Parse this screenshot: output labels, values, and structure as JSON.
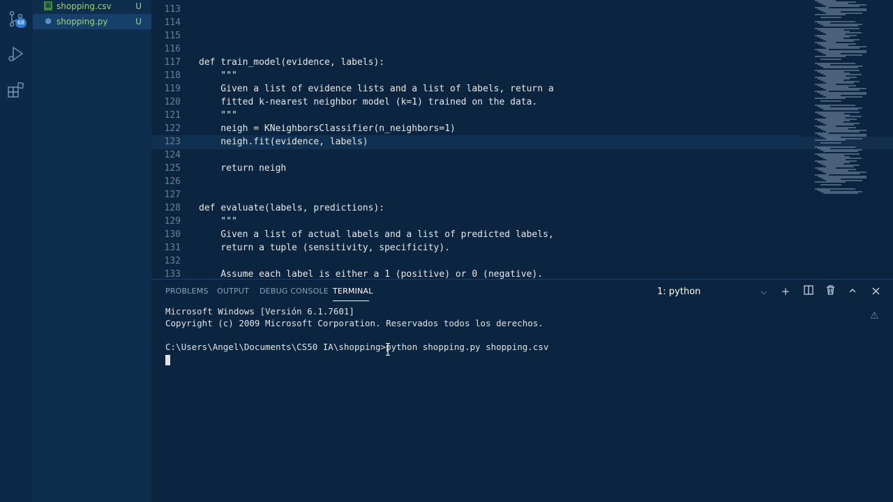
{
  "activity_bar": {
    "badge": "68",
    "icons": [
      "source-control-icon",
      "run-debug-icon",
      "extensions-icon"
    ]
  },
  "sidebar": {
    "files": [
      {
        "name": "shopping.csv",
        "status": "U",
        "icon": "csv-file-icon"
      },
      {
        "name": "shopping.py",
        "status": "U",
        "icon": "python-file-icon"
      }
    ]
  },
  "editor": {
    "lines": [
      {
        "n": "113",
        "code": ""
      },
      {
        "n": "114",
        "code": ""
      },
      {
        "n": "115",
        "code": ""
      },
      {
        "n": "116",
        "code": ""
      },
      {
        "n": "117",
        "code": "def train_model(evidence, labels):"
      },
      {
        "n": "118",
        "code": "    \"\"\""
      },
      {
        "n": "119",
        "code": "    Given a list of evidence lists and a list of labels, return a"
      },
      {
        "n": "120",
        "code": "    fitted k-nearest neighbor model (k=1) trained on the data."
      },
      {
        "n": "121",
        "code": "    \"\"\""
      },
      {
        "n": "122",
        "code": "    neigh = KNeighborsClassifier(n_neighbors=1)"
      },
      {
        "n": "123",
        "code": "    neigh.fit(evidence, labels)"
      },
      {
        "n": "124",
        "code": ""
      },
      {
        "n": "125",
        "code": "    return neigh"
      },
      {
        "n": "126",
        "code": ""
      },
      {
        "n": "127",
        "code": ""
      },
      {
        "n": "128",
        "code": "def evaluate(labels, predictions):"
      },
      {
        "n": "129",
        "code": "    \"\"\""
      },
      {
        "n": "130",
        "code": "    Given a list of actual labels and a list of predicted labels,"
      },
      {
        "n": "131",
        "code": "    return a tuple (sensitivity, specificity)."
      },
      {
        "n": "132",
        "code": ""
      },
      {
        "n": "133",
        "code": "    Assume each label is either a 1 (positive) or 0 (negative)."
      }
    ]
  },
  "panel": {
    "tabs": [
      "PROBLEMS",
      "OUTPUT",
      "DEBUG CONSOLE",
      "TERMINAL"
    ],
    "active_tab": "TERMINAL",
    "terminal_select": "1: python",
    "terminal_lines": [
      "Microsoft Windows [Versión 6.1.7601]",
      "Copyright (c) 2009 Microsoft Corporation. Reservados todos los derechos.",
      "",
      "C:\\Users\\Angel\\Documents\\CS50 IA\\shopping>python shopping.py shopping.csv"
    ],
    "buttons": [
      "plus-icon",
      "split-terminal-icon",
      "trash-icon",
      "chevron-up-icon",
      "close-icon"
    ]
  },
  "colors": {
    "background": "#0b2540",
    "sidebar": "#0e2c4b",
    "activity_bar": "#0c2a47",
    "file_untracked": "#9ed28a",
    "badge": "#2e7bd6"
  }
}
